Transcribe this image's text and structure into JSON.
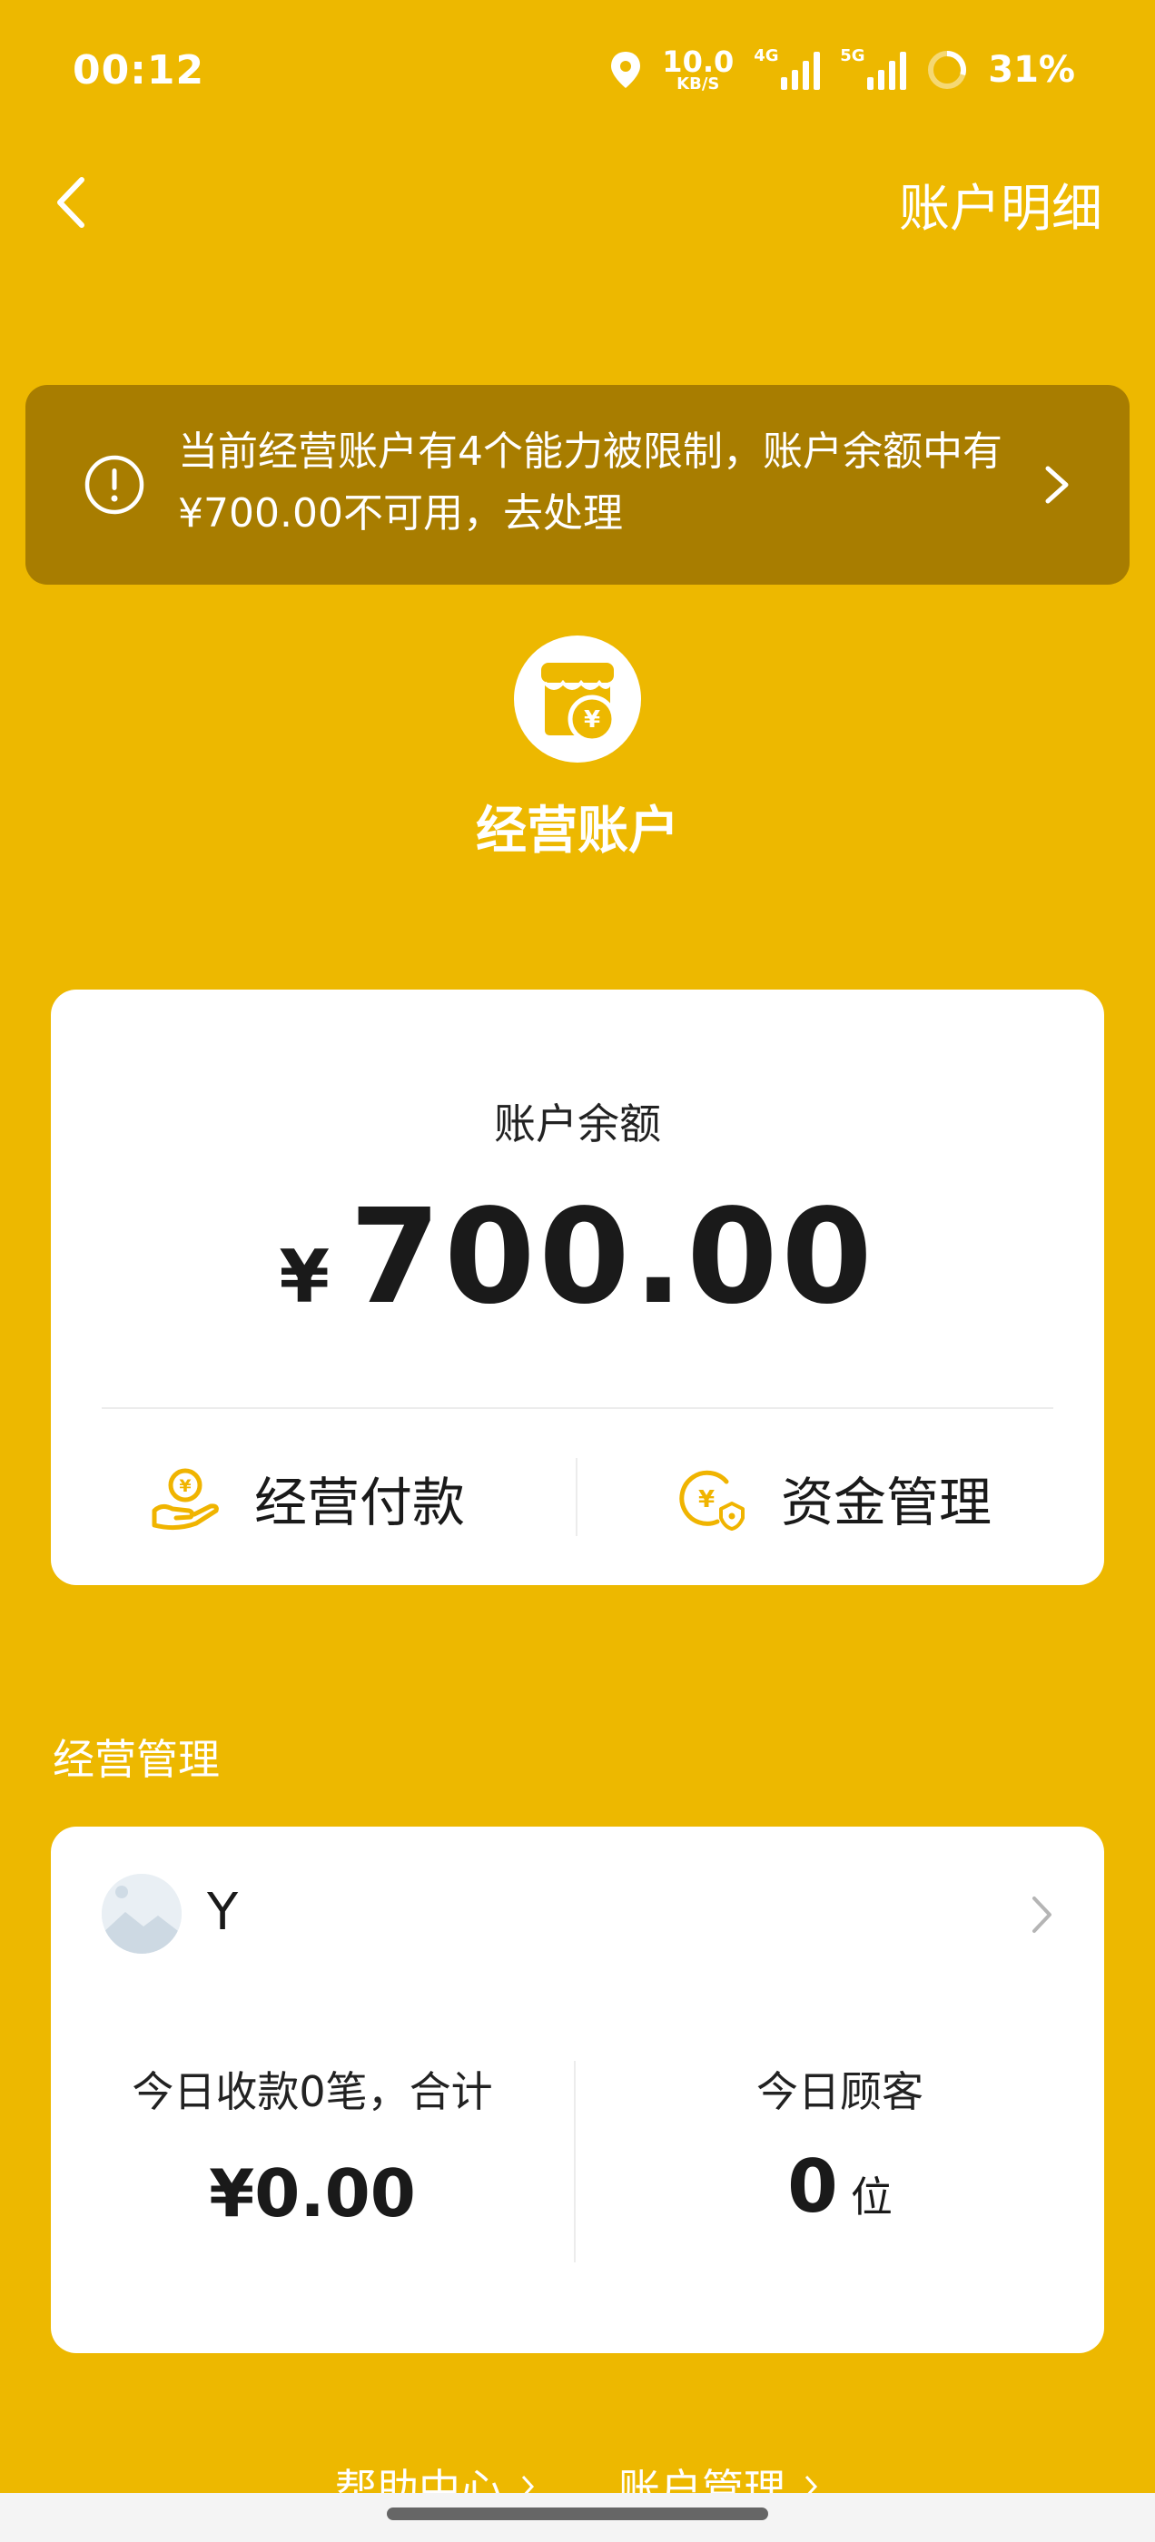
{
  "status_bar": {
    "time": "00:12",
    "net_speed_value": "10.0",
    "net_speed_unit": "KB/S",
    "sim1_tag": "4G",
    "sim2_tag": "5G",
    "battery": "31%"
  },
  "nav": {
    "back_icon": "chevron-left-icon",
    "right_action": "账户明细"
  },
  "alert": {
    "text": "当前经营账户有4个能力被限制，账户余额中有¥700.00不可用，去处理",
    "icon": "exclamation-circle-icon"
  },
  "account": {
    "title": "经营账户",
    "icon": "store-yuan-icon"
  },
  "balance": {
    "label": "账户余额",
    "currency": "¥",
    "amount": "700.00",
    "actions": [
      {
        "label": "经营付款",
        "icon": "hand-yuan-icon"
      },
      {
        "label": "资金管理",
        "icon": "yuan-shield-icon"
      }
    ]
  },
  "business": {
    "section_title": "经营管理",
    "store_name": "Y",
    "today_receipts_label": "今日收款0笔，合计",
    "today_receipts_value": "¥0.00",
    "today_customers_label": "今日顾客",
    "today_customers_value": "0",
    "today_customers_unit": "位"
  },
  "footer": {
    "links": [
      "帮助中心",
      "账户管理"
    ]
  },
  "colors": {
    "background": "#EDB800",
    "banner": "#A87D00",
    "accent": "#F0B400"
  }
}
